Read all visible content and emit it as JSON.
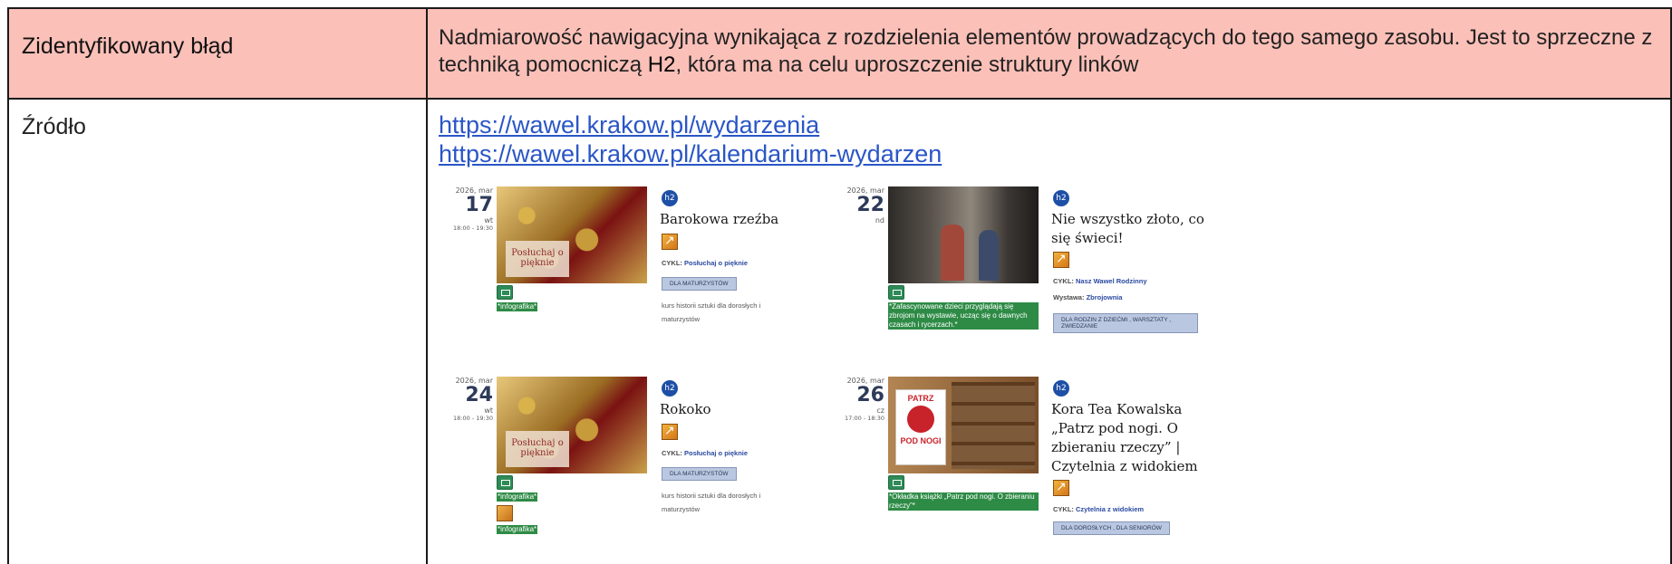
{
  "row1": {
    "label": "Zidentyfikowany błąd",
    "text_before": "Nadmiarowość nawigacyjna wynikająca z rozdzielenia elementów prowadzących do tego samego zasobu. Jest to sprzeczne z techniką pomocniczą ",
    "text_bold": "H2",
    "text_after": ", która ma na celu uproszczenie struktury linków"
  },
  "row2": {
    "label": "Źródło",
    "links": [
      "https://wawel.krakow.pl/wydarzenia",
      "https://wawel.krakow.pl/kalendarium-wydarzen"
    ]
  },
  "cards": [
    {
      "year_month": "2026, mar",
      "day": "17",
      "weekday": "wt",
      "time": "18:00 - 19:30",
      "image_text": "Posłuchaj o pięknie",
      "alt": "*infografika*",
      "h2": "h2",
      "title": "Barokowa rzeźba",
      "cykl_label": "CYKL:",
      "cykl_value": "Posłuchaj o pięknie",
      "tag": "DLA MATURZYSTÓW",
      "description": "kurs historii sztuki dla dorosłych i maturzystów"
    },
    {
      "year_month": "2026, mar",
      "day": "22",
      "weekday": "nd",
      "time": "",
      "alt": "*Zafascynowane dzieci przyglądają się zbrojom na wystawie, ucząc się o dawnych czasach i rycerzach.*",
      "h2": "h2",
      "title": "Nie wszystko złoto, co się świeci!",
      "cykl_label": "CYKL:",
      "cykl_value": "Nasz Wawel Rodzinny",
      "wystawa_label": "Wystawa:",
      "wystawa_value": "Zbrojownia",
      "tag": "DLA RODZIN Z DZIEĆMI , WARSZTATY , ZWIEDZANIE"
    },
    {
      "year_month": "2026, mar",
      "day": "24",
      "weekday": "wt",
      "time": "18:00 - 19:30",
      "image_text": "Posłuchaj o pięknie",
      "alt": "*infografika*",
      "alt2": "*infografika*",
      "h2": "h2",
      "title": "Rokoko",
      "cykl_label": "CYKL:",
      "cykl_value": "Posłuchaj o pięknie",
      "tag": "DLA MATURZYSTÓW",
      "description": "kurs historii sztuki dla dorosłych i maturzystów"
    },
    {
      "year_month": "2026, mar",
      "day": "26",
      "weekday": "cz",
      "time": "17:00 - 18:30",
      "image_text_top": "PATRZ",
      "image_text_bottom": "POD NOGI",
      "alt": "*Okładka książki „Patrz pod nogi. O zbieraniu rzeczy”*",
      "h2": "h2",
      "title": "Kora Tea Kowalska „Patrz pod nogi. O zbieraniu rzeczy” | Czytelnia z widokiem",
      "cykl_label": "CYKL:",
      "cykl_value": "Czytelnia z widokiem",
      "tag": "DLA DOROSŁYCH , DLA SENIORÓW"
    }
  ],
  "icons": {
    "info": "infographic-icon",
    "alt_image": "image-alt-icon",
    "external": "external-link-icon",
    "h2_marker": "h2-badge-icon"
  }
}
